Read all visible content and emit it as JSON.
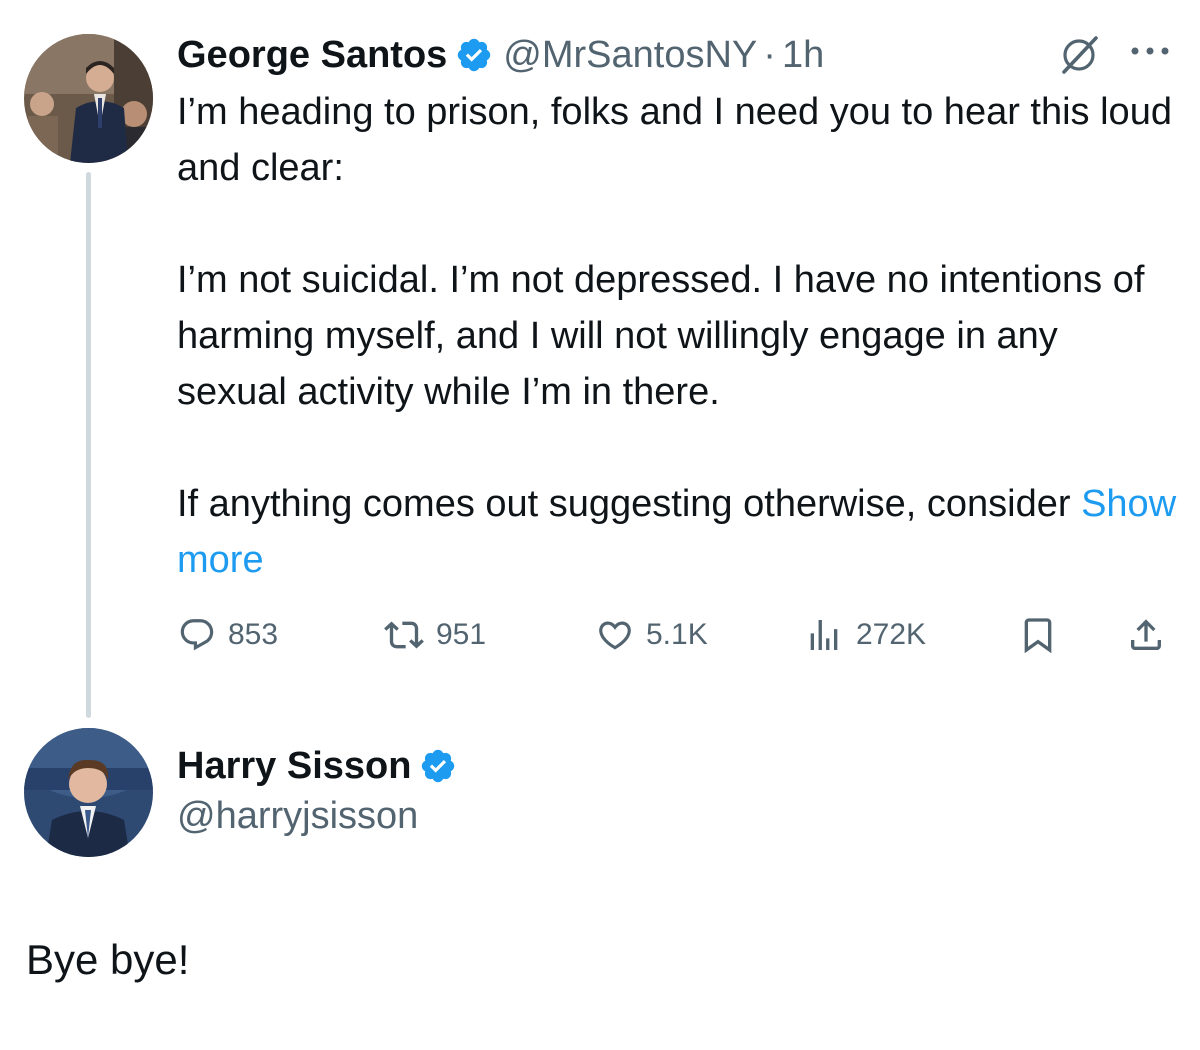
{
  "original_tweet": {
    "author_name": "George Santos",
    "handle": "@MrSantosNY",
    "separator": "·",
    "time": "1h",
    "verified_color": "#1d9bf0",
    "paragraphs": [
      "I’m heading to prison, folks and I need you to hear this loud and clear:",
      "I’m not suicidal. I’m not depressed. I have no intentions of harming myself, and I will not willingly engage in any sexual activity while I’m in there.",
      "If anything comes out suggesting otherwise, consider"
    ],
    "show_more": "Show more",
    "stats": {
      "replies": "853",
      "reposts": "951",
      "likes": "5.1K",
      "views": "272K"
    }
  },
  "quoting_user": {
    "name": "Harry Sisson",
    "handle": "@harryjsisson",
    "verified_color": "#1d9bf0"
  },
  "reply_text": "Bye bye!",
  "icons": {
    "grok": "grok-icon",
    "more": "more-icon",
    "reply": "reply-icon",
    "repost": "repost-icon",
    "like": "heart-icon",
    "views": "views-icon",
    "bookmark": "bookmark-icon",
    "share": "share-icon",
    "verified": "verified-badge-icon"
  }
}
